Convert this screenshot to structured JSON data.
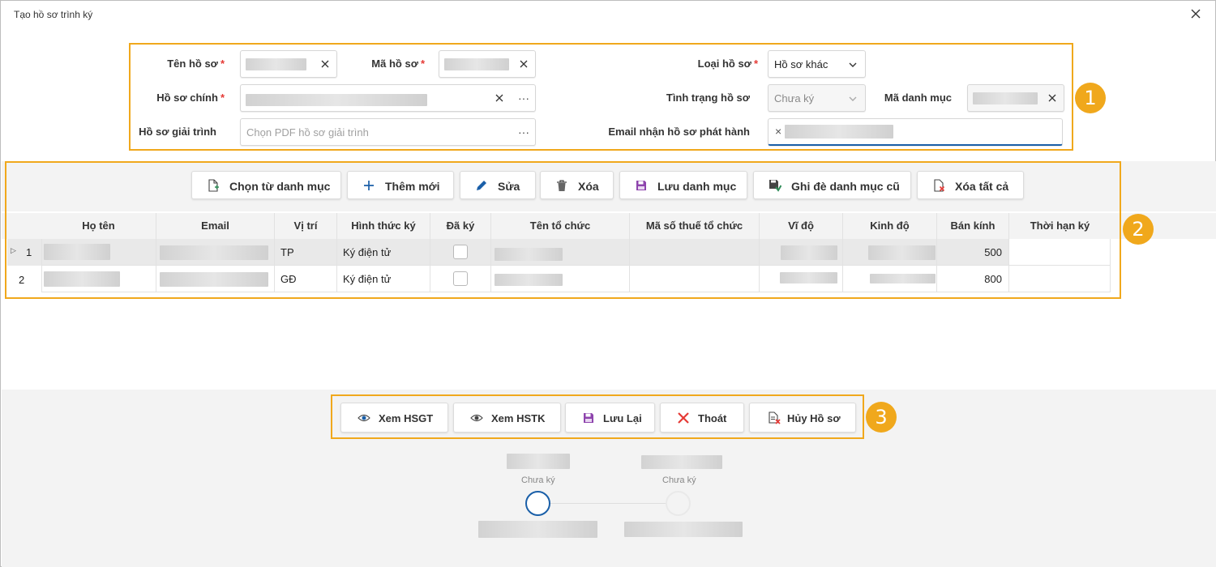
{
  "window": {
    "title": "Tạo hồ sơ trình ký",
    "close_icon": "close-icon"
  },
  "form": {
    "ten_ho_so": {
      "label": "Tên hồ sơ",
      "required": "*"
    },
    "ma_ho_so": {
      "label": "Mã hồ sơ",
      "required": "*"
    },
    "loai_ho_so": {
      "label": "Loại hồ sơ",
      "required": "*",
      "value": "Hồ sơ khác"
    },
    "ho_so_chinh": {
      "label": "Hồ sơ chính",
      "required": "*",
      "browse": "···"
    },
    "tinh_trang": {
      "label": "Tình trạng hồ sơ",
      "value": "Chưa ký"
    },
    "ma_danh_muc": {
      "label": "Mã danh mục"
    },
    "ho_so_giai_trinh": {
      "label": "Hồ sơ giải trình",
      "placeholder": "Chọn PDF hồ sơ  giải trình",
      "browse": "···"
    },
    "email_phat_hanh": {
      "label": "Email nhận hồ sơ phát hành",
      "remove": "×"
    }
  },
  "toolbar": [
    {
      "label": "Chọn từ danh mục",
      "icon": "document-add-icon"
    },
    {
      "label": "Thêm mới",
      "icon": "plus-icon"
    },
    {
      "label": "Sửa",
      "icon": "pencil-icon"
    },
    {
      "label": "Xóa",
      "icon": "trash-icon"
    },
    {
      "label": "Lưu danh mục",
      "icon": "save-icon"
    },
    {
      "label": "Ghi đè danh mục cũ",
      "icon": "save-overwrite-icon"
    },
    {
      "label": "Xóa tất cả",
      "icon": "document-delete-icon"
    }
  ],
  "table": {
    "columns": [
      "Họ tên",
      "Email",
      "Vị trí",
      "Hình thức ký",
      "Đã ký",
      "Tên tổ chức",
      "Mã số thuế tổ chức",
      "Vĩ độ",
      "Kinh độ",
      "Bán kính",
      "Thời hạn ký"
    ],
    "rows": [
      {
        "index": "1",
        "vi_tri": "TP",
        "hinh_thuc": "Ký điện tử",
        "ban_kinh": "500"
      },
      {
        "index": "2",
        "vi_tri": "GĐ",
        "hinh_thuc": "Ký điện tử",
        "ban_kinh": "800"
      }
    ]
  },
  "actions": [
    {
      "label": "Xem HSGT",
      "icon": "eye-icon"
    },
    {
      "label": "Xem HSTK",
      "icon": "eye-icon"
    },
    {
      "label": "Lưu Lại",
      "icon": "save-icon"
    },
    {
      "label": "Thoát",
      "icon": "close-icon"
    },
    {
      "label": "Hủy Hồ sơ",
      "icon": "document-cancel-icon"
    }
  ],
  "workflow": {
    "steps": [
      {
        "status": "Chưa ký",
        "active": true
      },
      {
        "status": "Chưa ký",
        "active": false
      }
    ]
  },
  "callouts": [
    "1",
    "2",
    "3"
  ],
  "colors": {
    "accent": "#f0a81c",
    "primary": "#1a5fa8",
    "required": "#e53935",
    "save_purple": "#8e44ad",
    "delete_red": "#e53935"
  }
}
